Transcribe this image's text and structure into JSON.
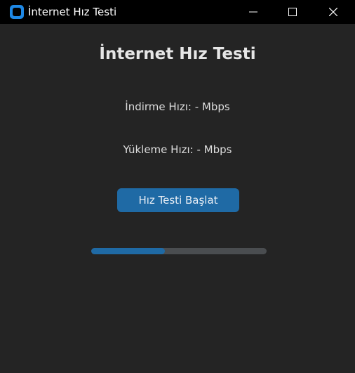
{
  "window": {
    "title": "İnternet Hız Testi",
    "app_icon": "app-icon",
    "controls": [
      "minimize-icon",
      "maximize-icon",
      "close-icon"
    ]
  },
  "main": {
    "heading": "İnternet Hız Testi",
    "download_text": "İndirme Hızı: - Mbps",
    "upload_text": "Yükleme Hızı: - Mbps",
    "start_button_label": "Hız Testi Başlat",
    "progress": 0.42
  },
  "colors": {
    "background": "#242424",
    "titlebar": "#000000",
    "accent": "#1f6aa5",
    "track": "#4a4d50"
  }
}
